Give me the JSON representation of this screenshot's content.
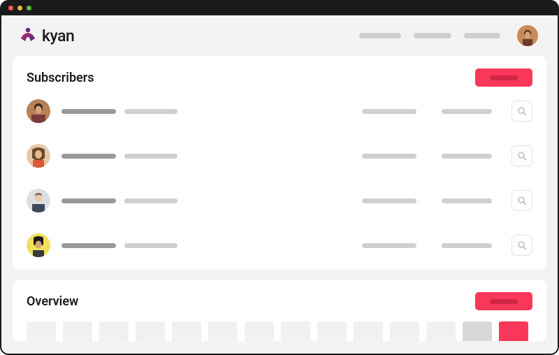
{
  "brand": {
    "name": "kyan"
  },
  "sections": {
    "subscribers": {
      "title": "Subscribers"
    },
    "overview": {
      "title": "Overview"
    }
  },
  "subscribers": [
    {
      "avatar_bg": "#b78257"
    },
    {
      "avatar_bg": "#d89a6f"
    },
    {
      "avatar_bg": "#cfd4d8"
    },
    {
      "avatar_bg": "#f3e05a"
    }
  ]
}
